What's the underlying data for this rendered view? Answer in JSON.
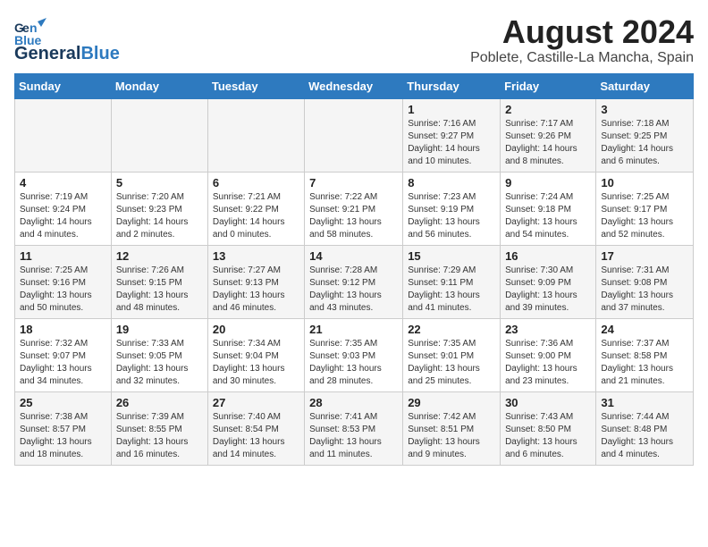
{
  "logo": {
    "part1": "General",
    "part2": "Blue"
  },
  "title": "August 2024",
  "location": "Poblete, Castille-La Mancha, Spain",
  "weekdays": [
    "Sunday",
    "Monday",
    "Tuesday",
    "Wednesday",
    "Thursday",
    "Friday",
    "Saturday"
  ],
  "weeks": [
    [
      {
        "day": "",
        "info": ""
      },
      {
        "day": "",
        "info": ""
      },
      {
        "day": "",
        "info": ""
      },
      {
        "day": "",
        "info": ""
      },
      {
        "day": "1",
        "info": "Sunrise: 7:16 AM\nSunset: 9:27 PM\nDaylight: 14 hours\nand 10 minutes."
      },
      {
        "day": "2",
        "info": "Sunrise: 7:17 AM\nSunset: 9:26 PM\nDaylight: 14 hours\nand 8 minutes."
      },
      {
        "day": "3",
        "info": "Sunrise: 7:18 AM\nSunset: 9:25 PM\nDaylight: 14 hours\nand 6 minutes."
      }
    ],
    [
      {
        "day": "4",
        "info": "Sunrise: 7:19 AM\nSunset: 9:24 PM\nDaylight: 14 hours\nand 4 minutes."
      },
      {
        "day": "5",
        "info": "Sunrise: 7:20 AM\nSunset: 9:23 PM\nDaylight: 14 hours\nand 2 minutes."
      },
      {
        "day": "6",
        "info": "Sunrise: 7:21 AM\nSunset: 9:22 PM\nDaylight: 14 hours\nand 0 minutes."
      },
      {
        "day": "7",
        "info": "Sunrise: 7:22 AM\nSunset: 9:21 PM\nDaylight: 13 hours\nand 58 minutes."
      },
      {
        "day": "8",
        "info": "Sunrise: 7:23 AM\nSunset: 9:19 PM\nDaylight: 13 hours\nand 56 minutes."
      },
      {
        "day": "9",
        "info": "Sunrise: 7:24 AM\nSunset: 9:18 PM\nDaylight: 13 hours\nand 54 minutes."
      },
      {
        "day": "10",
        "info": "Sunrise: 7:25 AM\nSunset: 9:17 PM\nDaylight: 13 hours\nand 52 minutes."
      }
    ],
    [
      {
        "day": "11",
        "info": "Sunrise: 7:25 AM\nSunset: 9:16 PM\nDaylight: 13 hours\nand 50 minutes."
      },
      {
        "day": "12",
        "info": "Sunrise: 7:26 AM\nSunset: 9:15 PM\nDaylight: 13 hours\nand 48 minutes."
      },
      {
        "day": "13",
        "info": "Sunrise: 7:27 AM\nSunset: 9:13 PM\nDaylight: 13 hours\nand 46 minutes."
      },
      {
        "day": "14",
        "info": "Sunrise: 7:28 AM\nSunset: 9:12 PM\nDaylight: 13 hours\nand 43 minutes."
      },
      {
        "day": "15",
        "info": "Sunrise: 7:29 AM\nSunset: 9:11 PM\nDaylight: 13 hours\nand 41 minutes."
      },
      {
        "day": "16",
        "info": "Sunrise: 7:30 AM\nSunset: 9:09 PM\nDaylight: 13 hours\nand 39 minutes."
      },
      {
        "day": "17",
        "info": "Sunrise: 7:31 AM\nSunset: 9:08 PM\nDaylight: 13 hours\nand 37 minutes."
      }
    ],
    [
      {
        "day": "18",
        "info": "Sunrise: 7:32 AM\nSunset: 9:07 PM\nDaylight: 13 hours\nand 34 minutes."
      },
      {
        "day": "19",
        "info": "Sunrise: 7:33 AM\nSunset: 9:05 PM\nDaylight: 13 hours\nand 32 minutes."
      },
      {
        "day": "20",
        "info": "Sunrise: 7:34 AM\nSunset: 9:04 PM\nDaylight: 13 hours\nand 30 minutes."
      },
      {
        "day": "21",
        "info": "Sunrise: 7:35 AM\nSunset: 9:03 PM\nDaylight: 13 hours\nand 28 minutes."
      },
      {
        "day": "22",
        "info": "Sunrise: 7:35 AM\nSunset: 9:01 PM\nDaylight: 13 hours\nand 25 minutes."
      },
      {
        "day": "23",
        "info": "Sunrise: 7:36 AM\nSunset: 9:00 PM\nDaylight: 13 hours\nand 23 minutes."
      },
      {
        "day": "24",
        "info": "Sunrise: 7:37 AM\nSunset: 8:58 PM\nDaylight: 13 hours\nand 21 minutes."
      }
    ],
    [
      {
        "day": "25",
        "info": "Sunrise: 7:38 AM\nSunset: 8:57 PM\nDaylight: 13 hours\nand 18 minutes."
      },
      {
        "day": "26",
        "info": "Sunrise: 7:39 AM\nSunset: 8:55 PM\nDaylight: 13 hours\nand 16 minutes."
      },
      {
        "day": "27",
        "info": "Sunrise: 7:40 AM\nSunset: 8:54 PM\nDaylight: 13 hours\nand 14 minutes."
      },
      {
        "day": "28",
        "info": "Sunrise: 7:41 AM\nSunset: 8:53 PM\nDaylight: 13 hours\nand 11 minutes."
      },
      {
        "day": "29",
        "info": "Sunrise: 7:42 AM\nSunset: 8:51 PM\nDaylight: 13 hours\nand 9 minutes."
      },
      {
        "day": "30",
        "info": "Sunrise: 7:43 AM\nSunset: 8:50 PM\nDaylight: 13 hours\nand 6 minutes."
      },
      {
        "day": "31",
        "info": "Sunrise: 7:44 AM\nSunset: 8:48 PM\nDaylight: 13 hours\nand 4 minutes."
      }
    ]
  ]
}
